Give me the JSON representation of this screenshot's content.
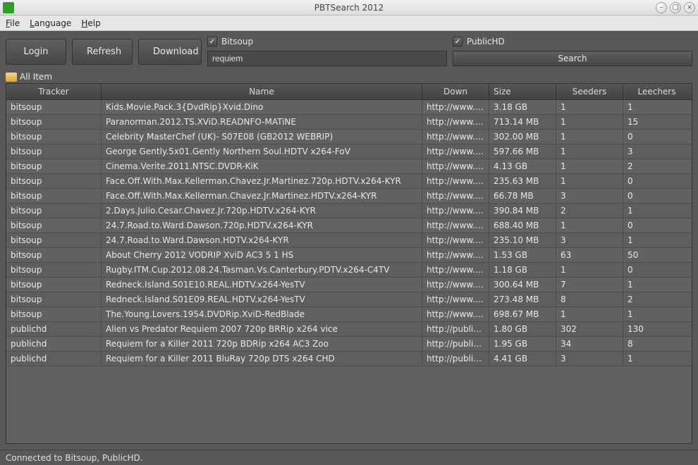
{
  "window": {
    "title": "PBTSearch 2012"
  },
  "menu": {
    "file": "File",
    "language": "Language",
    "help": "Help"
  },
  "toolbar": {
    "login": "Login",
    "refresh": "Refresh",
    "download": "Download"
  },
  "trackers": {
    "bitsoup": {
      "label": "Bitsoup",
      "checked": true
    },
    "publichd": {
      "label": "PublicHD",
      "checked": true
    }
  },
  "search": {
    "value": "requiem",
    "button": "Search"
  },
  "tab": {
    "label": "All Item"
  },
  "columns": {
    "tracker": "Tracker",
    "name": "Name",
    "down": "Down",
    "size": "Size",
    "seeders": "Seeders",
    "leechers": "Leechers"
  },
  "rows": [
    {
      "tracker": "bitsoup",
      "name": "Kids.Movie.Pack.3{DvdRip}Xvid.Dino",
      "down": "http://www.bi...",
      "size": "3.18 GB",
      "seed": "1",
      "leech": "1"
    },
    {
      "tracker": "bitsoup",
      "name": "Paranorman.2012.TS.XViD.READNFO-MATiNE",
      "down": "http://www.bi...",
      "size": "713.14 MB",
      "seed": "1",
      "leech": "15"
    },
    {
      "tracker": "bitsoup",
      "name": "Celebrity MasterChef (UK)- S07E08 (GB2012 WEBRIP)",
      "down": "http://www.bi...",
      "size": "302.00 MB",
      "seed": "1",
      "leech": "0"
    },
    {
      "tracker": "bitsoup",
      "name": "George Gently.5x01.Gently Northern Soul.HDTV x264-FoV",
      "down": "http://www.bi...",
      "size": "597.66 MB",
      "seed": "1",
      "leech": "3"
    },
    {
      "tracker": "bitsoup",
      "name": "Cinema.Verite.2011.NTSC.DVDR-KiK",
      "down": "http://www.bi...",
      "size": "4.13 GB",
      "seed": "1",
      "leech": "2"
    },
    {
      "tracker": "bitsoup",
      "name": "Face.Off.With.Max.Kellerman.Chavez.Jr.Martinez.720p.HDTV.x264-KYR",
      "down": "http://www.bi...",
      "size": "235.63 MB",
      "seed": "1",
      "leech": "0"
    },
    {
      "tracker": "bitsoup",
      "name": "Face.Off.With.Max.Kellerman.Chavez.Jr.Martinez.HDTV.x264-KYR",
      "down": "http://www.bi...",
      "size": "66.78 MB",
      "seed": "3",
      "leech": "0"
    },
    {
      "tracker": "bitsoup",
      "name": "2.Days.Julio.Cesar.Chavez.Jr.720p.HDTV.x264-KYR",
      "down": "http://www.bi...",
      "size": "390.84 MB",
      "seed": "2",
      "leech": "1"
    },
    {
      "tracker": "bitsoup",
      "name": "24.7.Road.to.Ward.Dawson.720p.HDTV.x264-KYR",
      "down": "http://www.bi...",
      "size": "688.40 MB",
      "seed": "1",
      "leech": "0"
    },
    {
      "tracker": "bitsoup",
      "name": "24.7.Road.to.Ward.Dawson.HDTV.x264-KYR",
      "down": "http://www.bi...",
      "size": "235.10 MB",
      "seed": "3",
      "leech": "1"
    },
    {
      "tracker": "bitsoup",
      "name": "About Cherry 2012 VODRIP XviD AC3 5 1 HS",
      "down": "http://www.bi...",
      "size": "1.53 GB",
      "seed": "63",
      "leech": "50"
    },
    {
      "tracker": "bitsoup",
      "name": "Rugby.ITM.Cup.2012.08.24.Tasman.Vs.Canterbury.PDTV.x264-C4TV",
      "down": "http://www.bi...",
      "size": "1.18 GB",
      "seed": "1",
      "leech": "0"
    },
    {
      "tracker": "bitsoup",
      "name": "Redneck.Island.S01E10.REAL.HDTV.x264-YesTV",
      "down": "http://www.bi...",
      "size": "300.64 MB",
      "seed": "7",
      "leech": "1"
    },
    {
      "tracker": "bitsoup",
      "name": "Redneck.Island.S01E09.REAL.HDTV.x264-YesTV",
      "down": "http://www.bi...",
      "size": "273.48 MB",
      "seed": "8",
      "leech": "2"
    },
    {
      "tracker": "bitsoup",
      "name": "The.Young.Lovers.1954.DVDRip.XviD-RedBlade",
      "down": "http://www.bi...",
      "size": "698.67 MB",
      "seed": "1",
      "leech": "1"
    },
    {
      "tracker": "publichd",
      "name": "Alien vs Predator Requiem 2007 720p BRRip x264 vice",
      "down": "http://public...",
      "size": "1.80 GB",
      "seed": "302",
      "leech": "130"
    },
    {
      "tracker": "publichd",
      "name": "Requiem for a Killer 2011 720p BDRip x264 AC3 Zoo",
      "down": "http://public...",
      "size": "1.95 GB",
      "seed": "34",
      "leech": "8"
    },
    {
      "tracker": "publichd",
      "name": "Requiem for a Killer 2011 BluRay 720p DTS x264 CHD",
      "down": "http://public...",
      "size": "4.41 GB",
      "seed": "3",
      "leech": "1"
    }
  ],
  "status": "Connected to Bitsoup, PublicHD."
}
